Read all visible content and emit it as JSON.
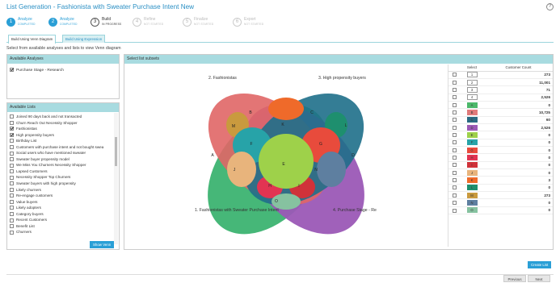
{
  "header": {
    "title": "List Generation - Fashionista with Sweater Purchase Intent New",
    "help_glyph": "?"
  },
  "steps": [
    {
      "num": "1",
      "label": "Analyze",
      "status": "COMPLETED",
      "state": "done"
    },
    {
      "num": "2",
      "label": "Analyze",
      "status": "COMPLETED",
      "state": "done"
    },
    {
      "num": "3",
      "label": "Build",
      "status": "IN PROGRESS",
      "state": "active"
    },
    {
      "num": "4",
      "label": "Refine",
      "status": "NOT STARTED",
      "state": "pend"
    },
    {
      "num": "5",
      "label": "Finalize",
      "status": "NOT STARTED",
      "state": "pend"
    },
    {
      "num": "6",
      "label": "Export",
      "status": "NOT STARTED",
      "state": "pend"
    }
  ],
  "tabs": {
    "venn": "Build Using Venn Diagram",
    "expression": "Build Using Expression"
  },
  "intro": "Select from available analyses and lists to view Venn diagram",
  "analyses": {
    "header": "Available Analyses",
    "items": [
      {
        "label": "Purchase Stage - Research",
        "checked": true
      }
    ]
  },
  "lists": {
    "header": "Available Lists",
    "items": [
      {
        "label": "Joined 90 days back and not transacted",
        "checked": false
      },
      {
        "label": "Churn Reach Out Necessity Shopper",
        "checked": false
      },
      {
        "label": "Fashionistas",
        "checked": true
      },
      {
        "label": "High propensity buyers",
        "checked": true
      },
      {
        "label": "Birthday List",
        "checked": false
      },
      {
        "label": "Customers with purchase intent and not bought swea",
        "checked": false
      },
      {
        "label": "Social users who have mentioned sweater",
        "checked": false
      },
      {
        "label": "Sweater buyer propensity model",
        "checked": false
      },
      {
        "label": "We Miss You Churners Necessity Shopper",
        "checked": false
      },
      {
        "label": "Lapsed Customers",
        "checked": false
      },
      {
        "label": "Necessity Shopper Top Churners",
        "checked": false
      },
      {
        "label": "Sweater buyers with high propensity",
        "checked": false
      },
      {
        "label": "Likely churners",
        "checked": false
      },
      {
        "label": "Re-engage customers",
        "checked": false
      },
      {
        "label": "Value buyers",
        "checked": false
      },
      {
        "label": "Likely adopters",
        "checked": false
      },
      {
        "label": "Category buyers",
        "checked": false
      },
      {
        "label": "Recent Customers",
        "checked": false
      },
      {
        "label": "Benefit List",
        "checked": false
      },
      {
        "label": "Churners",
        "checked": false
      }
    ],
    "show_button": "Show Venn"
  },
  "venn": {
    "header": "Select list subsets",
    "set_labels": {
      "s1": "1. Fashionistas with Sweater Purchase Intent",
      "s2": "2. Fashionistas",
      "s3": "3. High propensity buyers",
      "s4": "4. Purchase Stage - Re"
    },
    "region_letters": [
      "A",
      "B",
      "C",
      "D",
      "E",
      "F",
      "G",
      "H",
      "I",
      "J",
      "K",
      "L",
      "M",
      "N",
      "O"
    ],
    "colors": {
      "s1": "#3cb371",
      "s2": "#e06666",
      "s3": "#1e6f8a",
      "s4": "#9b59b6",
      "A": "#4cb86a",
      "B": "#e07b7b",
      "C": "#2a6b82",
      "D": "#9b5ab5",
      "E": "#9ed14a",
      "F": "#27a3a8",
      "G": "#e84b3c",
      "H": "#e23452",
      "I": "#d0323a",
      "J": "#e8b47c",
      "K": "#ef6a2a",
      "L": "#1e8f6e",
      "M": "#c99a3e",
      "N": "#5e7fa0",
      "O": "#86c2a0"
    }
  },
  "table": {
    "col_select": "Select",
    "col_count": "Customer Count",
    "rows": [
      {
        "key": "1",
        "count": "273",
        "color": ""
      },
      {
        "key": "2",
        "count": "11,001",
        "color": ""
      },
      {
        "key": "3",
        "count": "71",
        "color": ""
      },
      {
        "key": "4",
        "count": "2,526",
        "color": ""
      },
      {
        "key": "A",
        "count": "0",
        "color": "#4cb86a"
      },
      {
        "key": "B",
        "count": "10,725",
        "color": "#e07b7b"
      },
      {
        "key": "C",
        "count": "60",
        "color": "#2a6b82"
      },
      {
        "key": "D",
        "count": "2,526",
        "color": "#9b5ab5"
      },
      {
        "key": "E",
        "count": "0",
        "color": "#9ed14a"
      },
      {
        "key": "F",
        "count": "0",
        "color": "#27a3a8"
      },
      {
        "key": "G",
        "count": "0",
        "color": "#e84b3c"
      },
      {
        "key": "H",
        "count": "0",
        "color": "#e23452"
      },
      {
        "key": "I",
        "count": "0",
        "color": "#d0323a"
      },
      {
        "key": "J",
        "count": "0",
        "color": "#e8b47c"
      },
      {
        "key": "K",
        "count": "3",
        "color": "#ef6a2a"
      },
      {
        "key": "L",
        "count": "0",
        "color": "#1e8f6e"
      },
      {
        "key": "M",
        "count": "273",
        "color": "#c99a3e"
      },
      {
        "key": "N",
        "count": "0",
        "color": "#5e7fa0"
      },
      {
        "key": "O",
        "count": "0",
        "color": "#86c2a0"
      }
    ]
  },
  "footer": {
    "create": "Create List",
    "previous": "Previous",
    "next": "Next"
  }
}
